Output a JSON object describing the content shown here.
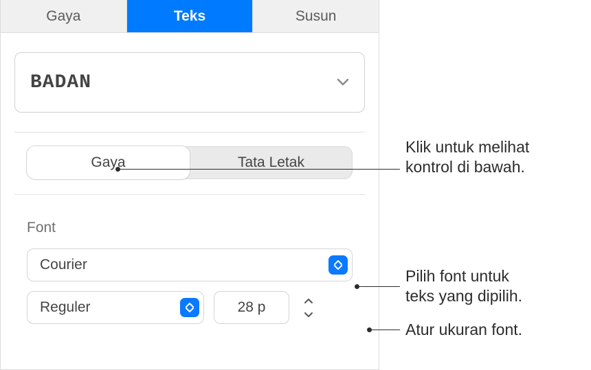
{
  "top_tabs": {
    "gaya": "Gaya",
    "teks": "Teks",
    "susun": "Susun"
  },
  "paragraph_style": {
    "name": "BADAN"
  },
  "segmented": {
    "gaya": "Gaya",
    "tata_letak": "Tata Letak"
  },
  "font_section": {
    "label": "Font",
    "family": "Courier",
    "weight": "Reguler",
    "size": "28 p"
  },
  "callouts": {
    "segmented": "Klik untuk melihat\nkontrol di bawah.",
    "font_family": "Pilih font untuk\nteks yang dipilih.",
    "font_size": "Atur ukuran font."
  }
}
